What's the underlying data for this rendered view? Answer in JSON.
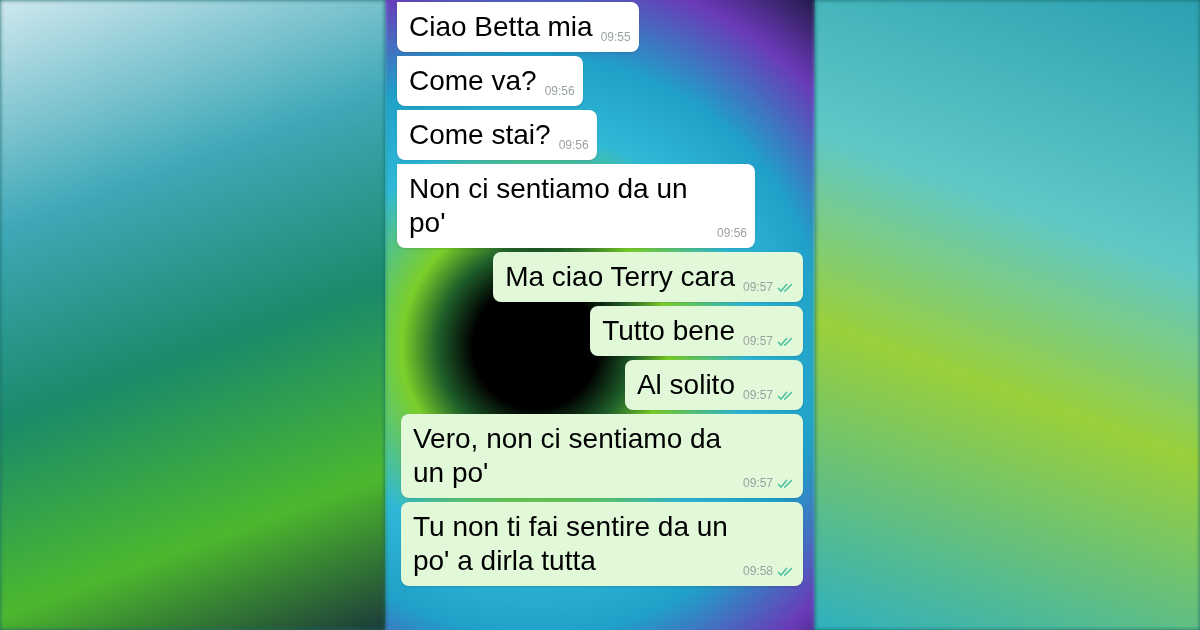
{
  "messages": [
    {
      "kind": "incoming",
      "text": "Ciao Betta mia",
      "time": "09:55"
    },
    {
      "kind": "incoming",
      "text": "Come va?",
      "time": "09:56"
    },
    {
      "kind": "incoming",
      "text": "Come stai?",
      "time": "09:56"
    },
    {
      "kind": "incoming",
      "text": "Non ci sentiamo da un po'",
      "time": "09:56"
    },
    {
      "kind": "outgoing",
      "text": "Ma ciao Terry cara",
      "time": "09:57"
    },
    {
      "kind": "outgoing",
      "text": "Tutto bene",
      "time": "09:57"
    },
    {
      "kind": "outgoing",
      "text": "Al solito",
      "time": "09:57"
    },
    {
      "kind": "outgoing",
      "text": "Vero, non ci sentiamo da un po'",
      "time": "09:57"
    },
    {
      "kind": "outgoing",
      "text": "Tu non ti fai sentire da un po' a dirla tutta",
      "time": "09:58"
    }
  ]
}
